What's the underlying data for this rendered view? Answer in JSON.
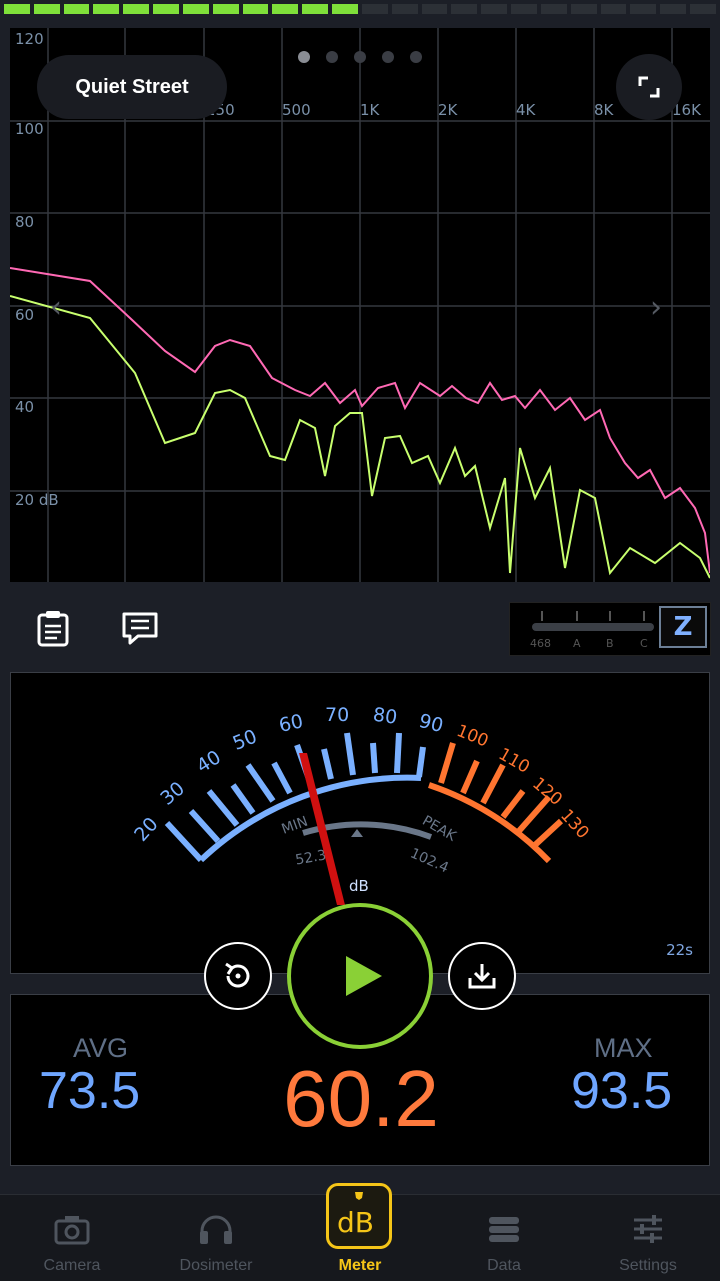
{
  "spectrum": {
    "y_labels": [
      "120",
      "100",
      "80",
      "60",
      "40",
      "20 dB"
    ],
    "x_labels": [
      "250",
      "500",
      "1K",
      "2K",
      "4K",
      "8K",
      "16K"
    ],
    "preset_label": "Quiet Street",
    "pages": 5,
    "active_page": 0,
    "series_colors": {
      "peak": "#ff69b4",
      "current": "#c8ff6e"
    }
  },
  "toolbar": {
    "notes_icon": "clipboard-icon",
    "comment_icon": "comment-icon"
  },
  "weighting": {
    "scale_labels": [
      "468",
      "A",
      "B",
      "C"
    ],
    "selected": "Z"
  },
  "meter": {
    "scale_blue": [
      "20",
      "30",
      "40",
      "50",
      "60",
      "70",
      "80",
      "90"
    ],
    "scale_orange": [
      "100",
      "110",
      "120",
      "130"
    ],
    "min_label": "MIN",
    "peak_label": "PEAK",
    "min_value": "52.3",
    "peak_value": "102.4",
    "unit": "dB",
    "needle_value": 60.2,
    "timer": "22s"
  },
  "stats": {
    "avg_label": "AVG",
    "avg_value": "73.5",
    "current_value": "60.2",
    "max_label": "MAX",
    "max_value": "93.5"
  },
  "nav": {
    "items": [
      {
        "label": "Camera",
        "icon": "camera-icon"
      },
      {
        "label": "Dosimeter",
        "icon": "headphones-icon"
      },
      {
        "label": "Meter",
        "icon": "db-icon"
      },
      {
        "label": "Data",
        "icon": "database-icon"
      },
      {
        "label": "Settings",
        "icon": "sliders-icon"
      }
    ],
    "active": 2
  },
  "colors": {
    "accent_green": "#8ad036",
    "accent_yellow": "#f5c518",
    "value_blue": "#6fa6ff",
    "value_orange": "#ff7a3d"
  }
}
